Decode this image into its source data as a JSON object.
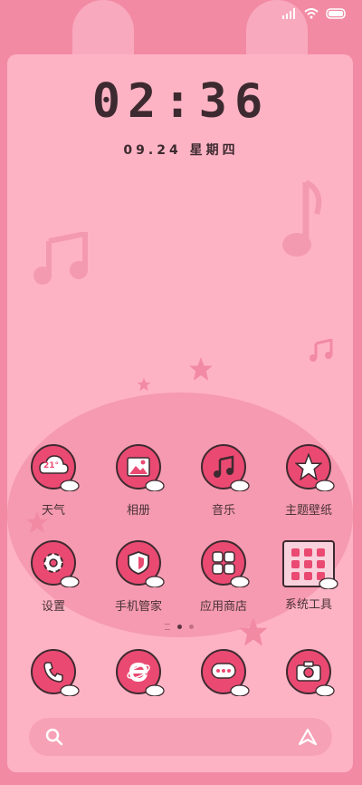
{
  "clock": {
    "time": "02:36",
    "date": "09.24 星期四"
  },
  "status": {
    "signal_icon": "signal-bars-icon",
    "wifi_icon": "wifi-icon",
    "battery_icon": "battery-icon"
  },
  "apps": [
    {
      "label": "天气",
      "icon": "weather-icon",
      "icon_text": "21°"
    },
    {
      "label": "相册",
      "icon": "gallery-icon"
    },
    {
      "label": "音乐",
      "icon": "music-icon"
    },
    {
      "label": "主题壁纸",
      "icon": "themes-icon"
    },
    {
      "label": "设置",
      "icon": "settings-icon"
    },
    {
      "label": "手机管家",
      "icon": "security-icon"
    },
    {
      "label": "应用商店",
      "icon": "app-store-icon"
    },
    {
      "label": "系统工具",
      "icon": "system-tools-folder-icon"
    }
  ],
  "dock": [
    {
      "icon": "phone-icon"
    },
    {
      "icon": "browser-icon"
    },
    {
      "icon": "messages-icon"
    },
    {
      "icon": "camera-icon"
    }
  ],
  "page_indicator": {
    "pages": 2,
    "current": 1
  },
  "search": {
    "icon": "search-icon",
    "assistant_icon": "assistant-icon"
  },
  "colors": {
    "background": "#f28aa4",
    "card": "#feb3c4",
    "accent": "#ea4a72",
    "text": "#3d2a30"
  }
}
